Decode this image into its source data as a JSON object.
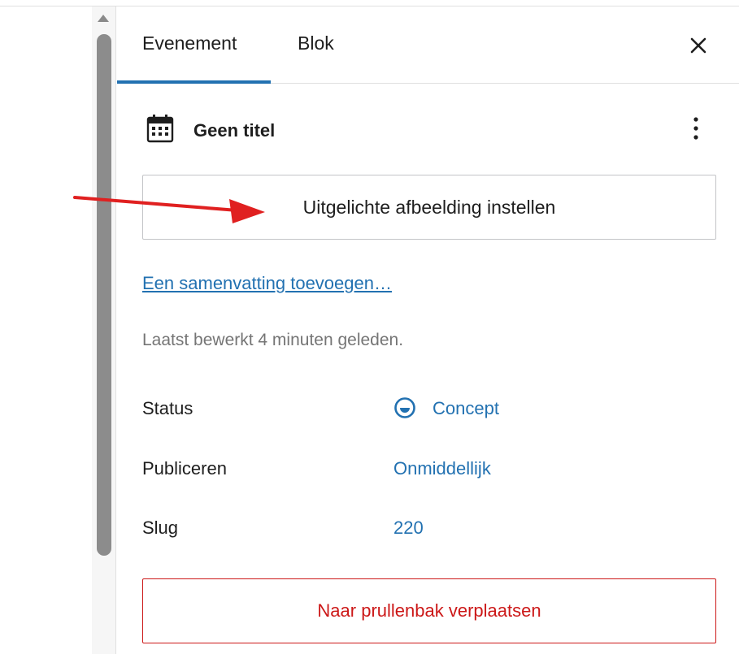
{
  "tabs": [
    {
      "label": "Evenement",
      "active": true
    },
    {
      "label": "Blok",
      "active": false
    }
  ],
  "post": {
    "title": "Geen titel",
    "icon": "calendar-icon"
  },
  "featured_image_button": "Uitgelichte afbeelding instellen",
  "excerpt_link": "Een samenvatting toevoegen…",
  "last_edited": "Laatst bewerkt 4 minuten geleden.",
  "meta": {
    "status": {
      "label": "Status",
      "value": "Concept"
    },
    "publish": {
      "label": "Publiceren",
      "value": "Onmiddellijk"
    },
    "slug": {
      "label": "Slug",
      "value": "220"
    }
  },
  "trash_button": "Naar prullenbak verplaatsen",
  "colors": {
    "accent": "#2271b1",
    "danger": "#cc1818",
    "annotation_arrow": "#e02020"
  }
}
